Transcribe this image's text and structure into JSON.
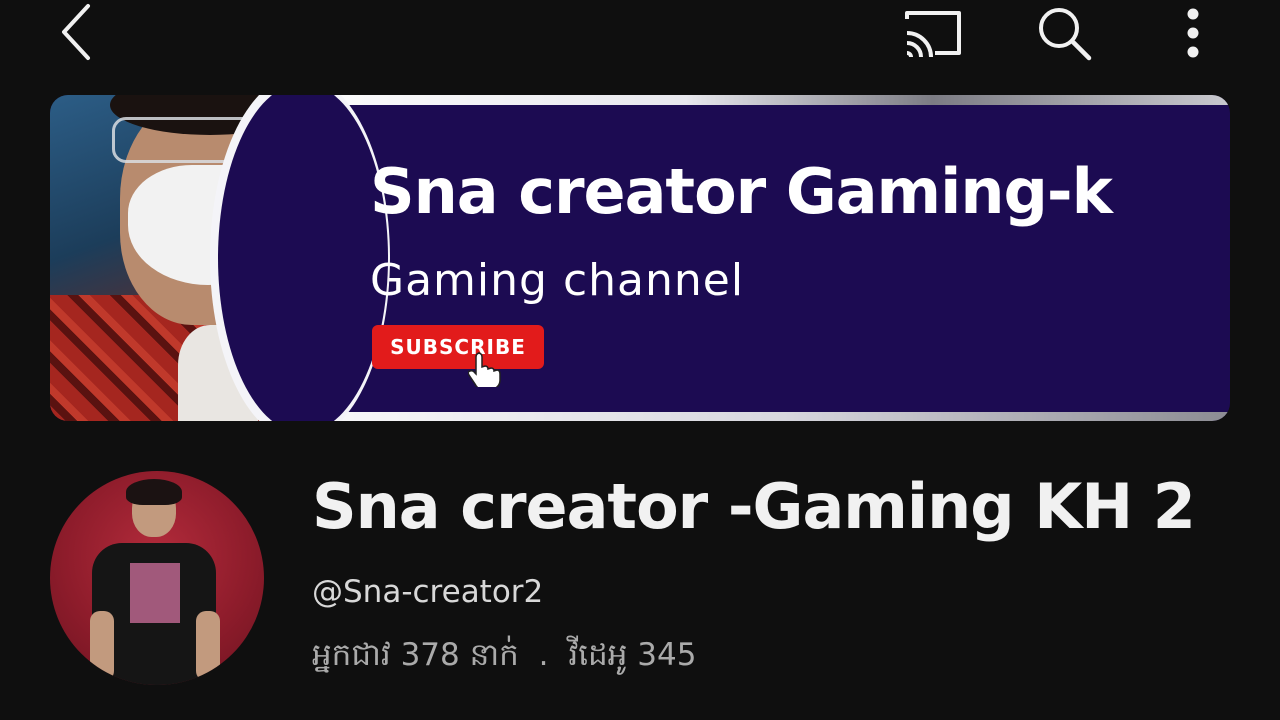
{
  "topbar": {
    "back_icon": "chevron-left-icon",
    "cast_icon": "cast-icon",
    "search_icon": "search-icon",
    "more_icon": "more-vertical-icon"
  },
  "banner": {
    "title": "Sna creator Gaming-k",
    "subtitle": "Gaming channel",
    "subscribe_label": "SUBSCRIBE",
    "bg_color": "#1c0b52",
    "subscribe_color": "#e21b1b"
  },
  "channel": {
    "name": "Sna creator -Gaming KH 2",
    "handle": "@Sna-creator2",
    "subscribers_label": "អ្នកជាវ 378 នាក់",
    "separator": ".",
    "videos_label": "វីដេអូ 345"
  }
}
